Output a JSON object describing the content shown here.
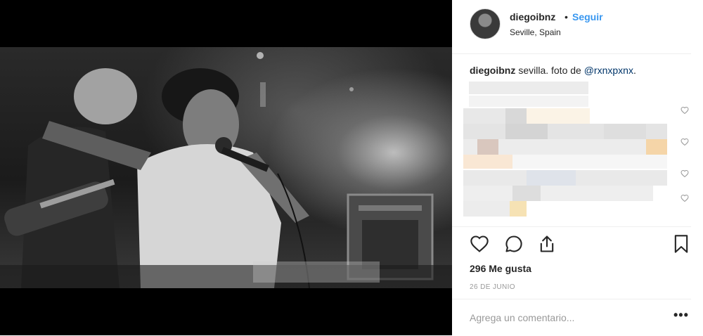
{
  "post": {
    "username": "diegoibnz",
    "separator": "•",
    "follow_label": "Seguir",
    "location": "Seville, Spain",
    "caption_username": "diegoibnz",
    "caption_text": "sevilla. foto de ",
    "caption_mention": "@rxnxpxnx",
    "caption_end": ".",
    "likes": "296 Me gusta",
    "date": "26 DE JUNIO",
    "comment_placeholder": "Agrega un comentario...",
    "more_label": "•••"
  },
  "icons": {
    "like": "heart-icon",
    "comment": "comment-bubble-icon",
    "share": "share-icon",
    "save": "bookmark-icon",
    "comment_like": "small-heart-icon"
  },
  "colors": {
    "accent": "#3897f0",
    "mention": "#003569",
    "muted": "#999999",
    "border": "#efefef"
  }
}
